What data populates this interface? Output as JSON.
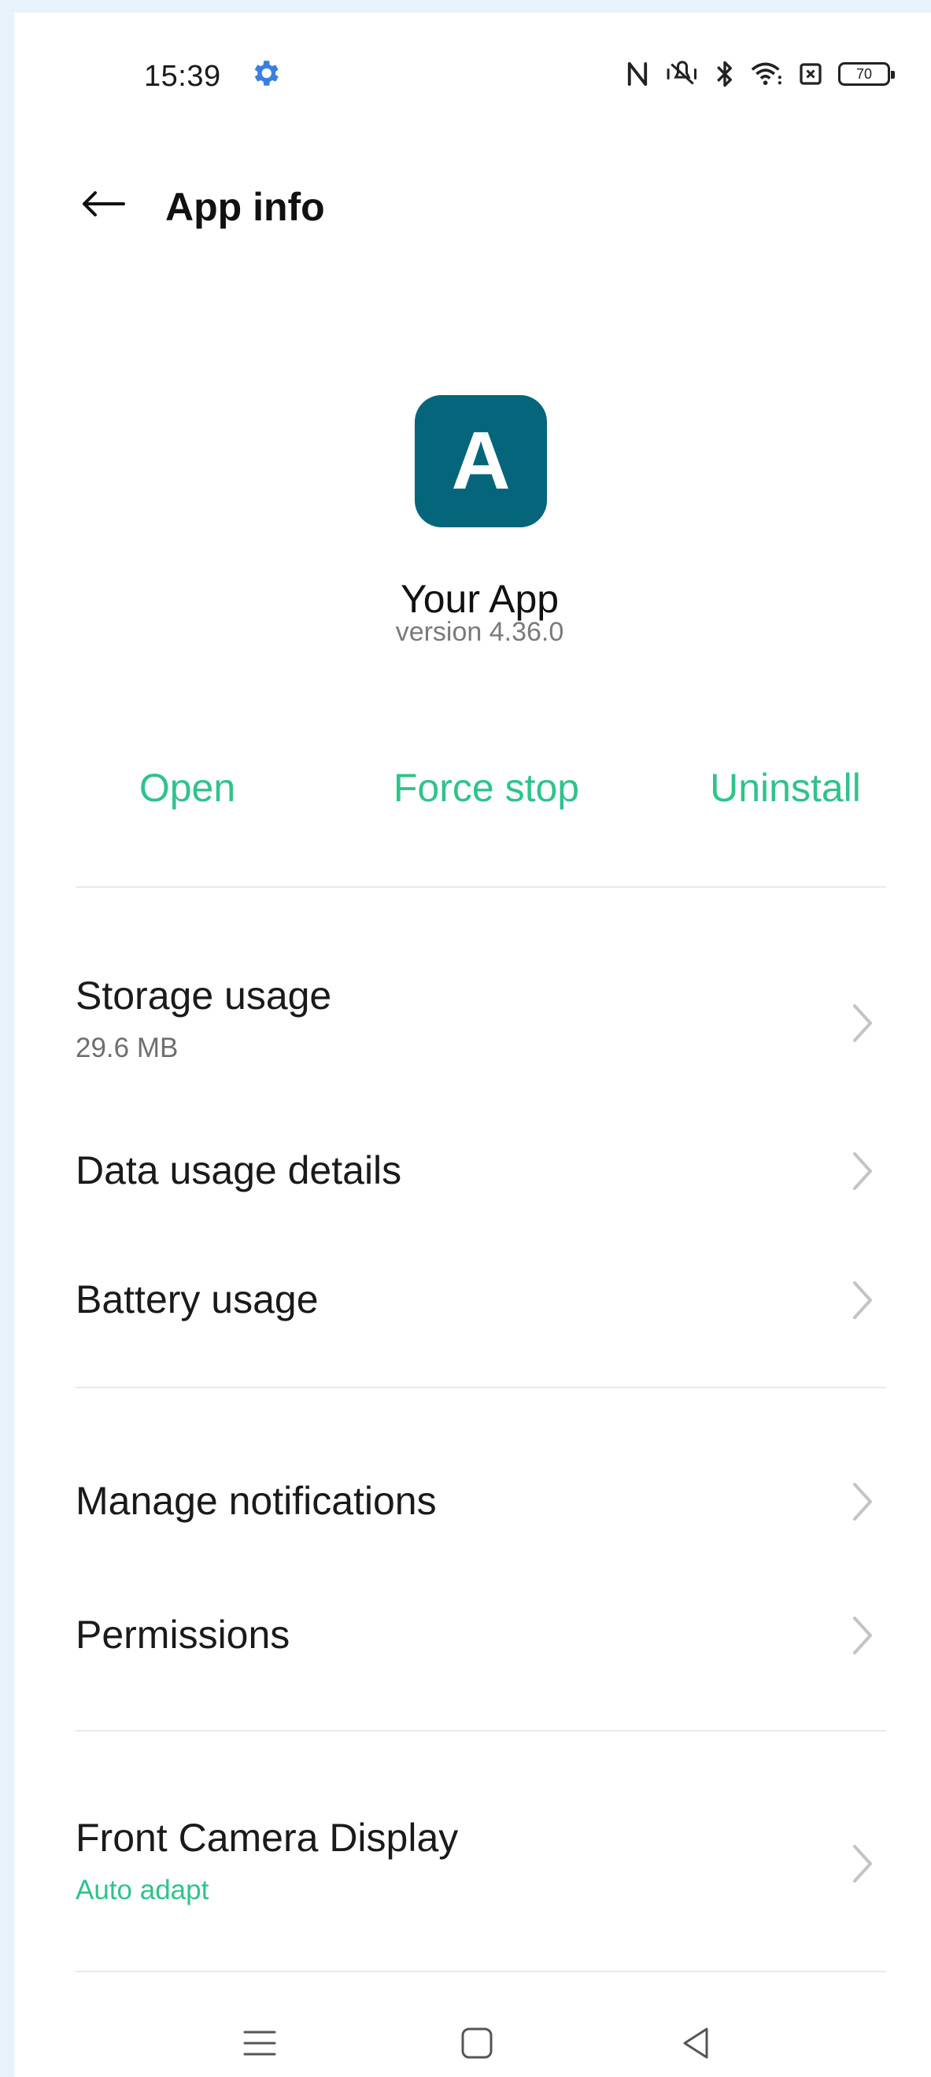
{
  "status_bar": {
    "time": "15:39",
    "icons": [
      "settings-icon",
      "nfc-icon",
      "vibrate-icon",
      "bluetooth-icon",
      "wifi-icon",
      "sim-off-icon",
      "battery-icon"
    ],
    "battery_level": "70"
  },
  "header": {
    "back_icon": "arrow-left-icon",
    "title": "App info"
  },
  "app": {
    "icon_letter": "A",
    "icon_color": "#05667b",
    "name": "Your App",
    "version": "version 4.36.0"
  },
  "actions": {
    "open": "Open",
    "force_stop": "Force stop",
    "uninstall": "Uninstall",
    "accent_color": "#2fc38a"
  },
  "settings": {
    "storage": {
      "title": "Storage usage",
      "value": "29.6 MB"
    },
    "data_usage": {
      "title": "Data usage details"
    },
    "battery": {
      "title": "Battery usage"
    },
    "notifications": {
      "title": "Manage notifications"
    },
    "permissions": {
      "title": "Permissions"
    },
    "front_camera": {
      "title": "Front Camera Display",
      "value": "Auto adapt"
    }
  },
  "nav_bar": {
    "icons": [
      "menu-icon",
      "home-icon",
      "back-icon"
    ]
  }
}
